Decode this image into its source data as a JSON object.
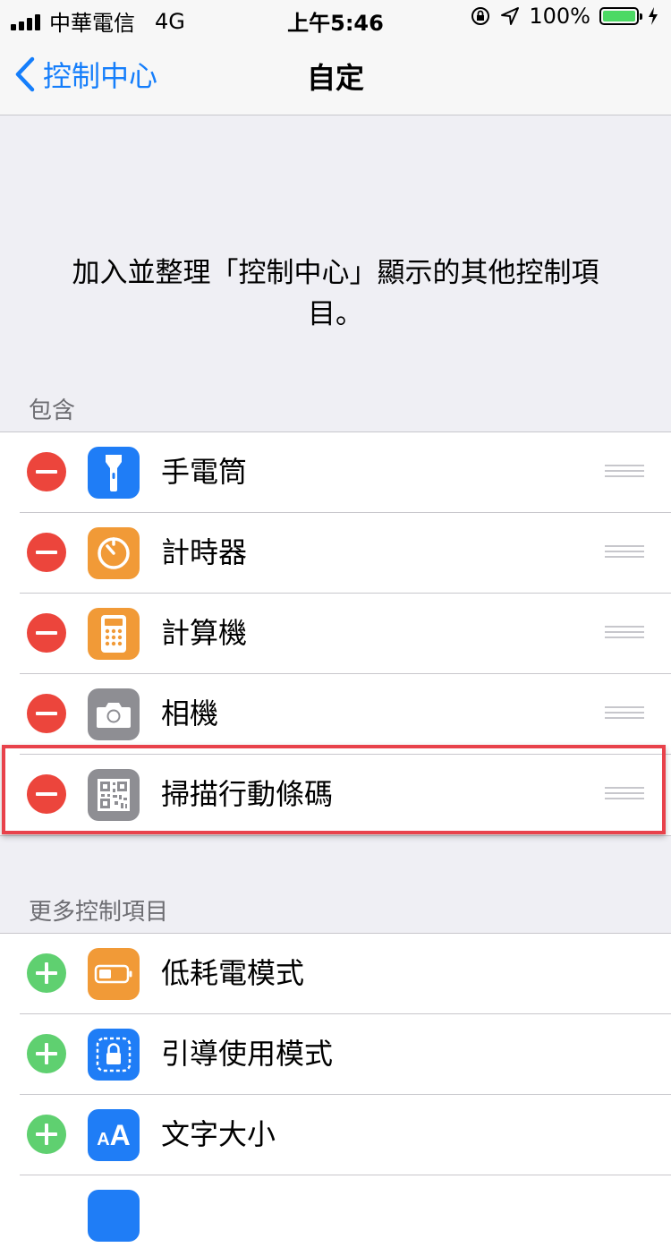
{
  "status_bar": {
    "carrier": "中華電信",
    "network": "4G",
    "time": "上午5:46",
    "battery_percent": "100%",
    "battery_level": 1.0
  },
  "nav": {
    "back_label": "控制中心",
    "title": "自定"
  },
  "description": "加入並整理「控制中心」顯示的其他控制項目。",
  "included": {
    "header": "包含",
    "items": [
      {
        "label": "手電筒",
        "icon": "flashlight-icon",
        "color": "#1f7df6"
      },
      {
        "label": "計時器",
        "icon": "timer-icon",
        "color": "#f19a37"
      },
      {
        "label": "計算機",
        "icon": "calculator-icon",
        "color": "#f19a37"
      },
      {
        "label": "相機",
        "icon": "camera-icon",
        "color": "#8e8e93"
      },
      {
        "label": "掃描行動條碼",
        "icon": "qr-code-icon",
        "color": "#8e8e93"
      }
    ]
  },
  "more": {
    "header": "更多控制項目",
    "items": [
      {
        "label": "低耗電模式",
        "icon": "battery-icon",
        "color": "#f19a37"
      },
      {
        "label": "引導使用模式",
        "icon": "lock-icon",
        "color": "#1f7df6"
      },
      {
        "label": "文字大小",
        "icon": "text-size-icon",
        "color": "#1f7df6",
        "glyph": "AA"
      }
    ]
  },
  "colors": {
    "accent": "#157efb",
    "remove": "#ec453c",
    "add": "#5fd070",
    "highlight": "#e8424b"
  }
}
